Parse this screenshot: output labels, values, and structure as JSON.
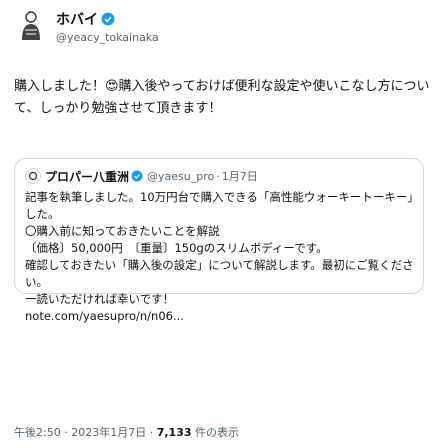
{
  "author": {
    "display_name": "ホバイ",
    "handle": "@yeacy_tokainaka"
  },
  "tweet": {
    "text": "購入しました！😍購入後やっておけば便利な設定や使いこなし方について、しっかり勉強させて頂きます！"
  },
  "quote": {
    "display_name": "プロパー八重洲",
    "handle": "@yaesu_pro",
    "date": "1月7日",
    "lines": [
      "記事を執筆しました。10万円台で購入できる「高性能ウォーキートーキー」を紹介しま",
      "した。",
      "〇購入前に知っておきたいことを解説",
      "〔価格〕50,000円　〔重量〕150gのスリムボディーです。",
      "確認しておきたい「購入後の設定」について解説します。最初にご覧ください",
      "い。",
      "一読いただければ幸いです！",
      "note.com/yaesupro/n/n06..."
    ]
  },
  "meta": {
    "time": "午後2:50",
    "date": "2023年1月7日",
    "views": "7,133",
    "views_label": "件の表示"
  },
  "colors": {
    "verified": "#1d9bf0",
    "muted": "#536471",
    "border": "#cfd9de"
  }
}
